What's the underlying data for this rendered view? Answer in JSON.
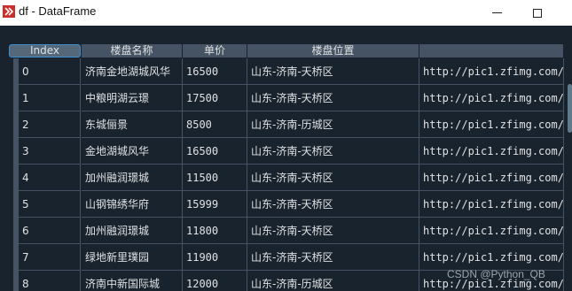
{
  "window": {
    "title": "df - DataFrame"
  },
  "table": {
    "columns": [
      "Index",
      "楼盘名称",
      "单价",
      "楼盘位置",
      ""
    ],
    "rows": [
      {
        "index": "0",
        "name": "济南金地湖城风华",
        "price": "16500",
        "location": "山东-济南-天桥区",
        "url": "http://pic1.zfimg.com/"
      },
      {
        "index": "1",
        "name": "中粮明湖云璟",
        "price": "17500",
        "location": "山东-济南-天桥区",
        "url": "http://pic1.zfimg.com/"
      },
      {
        "index": "2",
        "name": "东城俪景",
        "price": "8500",
        "location": "山东-济南-历城区",
        "url": "http://pic1.zfimg.com/"
      },
      {
        "index": "3",
        "name": "金地湖城风华",
        "price": "16500",
        "location": "山东-济南-天桥区",
        "url": "http://pic1.zfimg.com/"
      },
      {
        "index": "4",
        "name": "加州融润璟城",
        "price": "11500",
        "location": "山东-济南-天桥区",
        "url": "http://pic1.zfimg.com/"
      },
      {
        "index": "5",
        "name": "山钢锦绣华府",
        "price": "15999",
        "location": "山东-济南-天桥区",
        "url": "http://pic1.zfimg.com/"
      },
      {
        "index": "6",
        "name": "加州融润璟城",
        "price": "11800",
        "location": "山东-济南-天桥区",
        "url": "http://pic1.zfimg.com/"
      },
      {
        "index": "7",
        "name": "绿地新里璞园",
        "price": "11900",
        "location": "山东-济南-天桥区",
        "url": "http://pic1.zfimg.com/"
      },
      {
        "index": "8",
        "name": "济南中新国际城",
        "price": "12000",
        "location": "山东-济南-历城区",
        "url": "http://pic1.zfimg.com/"
      }
    ]
  },
  "watermark": "CSDN @Python_QB"
}
